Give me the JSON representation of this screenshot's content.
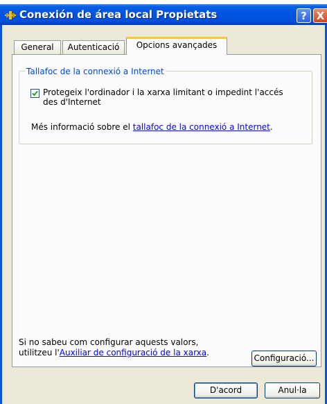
{
  "window": {
    "title": "Conexión de área local Propietats",
    "help_label": "?",
    "close_label": "X"
  },
  "tabs": [
    {
      "label": "General"
    },
    {
      "label": "Autenticació"
    },
    {
      "label": "Opcions avançades",
      "active": true
    }
  ],
  "firewall_group": {
    "title": "Tallafoc de la connexió a Internet",
    "checkbox_label": "Protegeix l'ordinador i la xarxa limitant o impedint l'accés des d'Internet",
    "checked": true,
    "info_prefix": "Més informació sobre el ",
    "info_link": "tallafoc de la connexió a Internet",
    "info_suffix": "."
  },
  "help_section": {
    "line1": "Si no sabeu com configurar aquests valors,",
    "line2_prefix": "utilitzeu l'",
    "wizard_link": "Auxiliar de configuració de la xarxa",
    "line2_suffix": "."
  },
  "buttons": {
    "settings": "Configuració...",
    "ok": "D'acord",
    "cancel": "Anul·la"
  },
  "colors": {
    "titlebar": "#0054e3",
    "active_tab_accent": "#ffc83c",
    "group_title": "#0046d5",
    "link": "#0000ff"
  }
}
